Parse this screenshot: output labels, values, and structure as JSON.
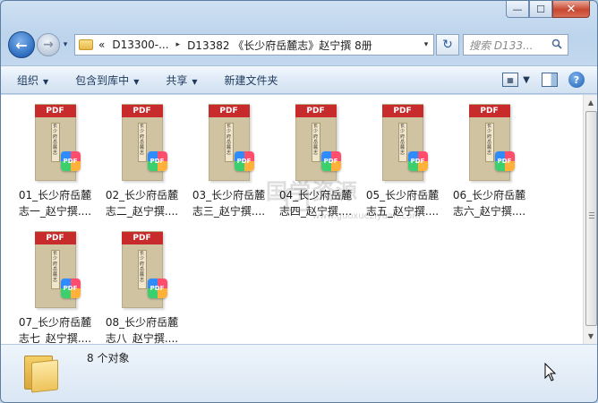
{
  "window": {
    "caption_buttons": {
      "minimize": "—",
      "maximize": "☐",
      "close": "✕"
    }
  },
  "nav": {
    "back_glyph": "←",
    "forward_glyph": "→",
    "history_glyph": "▾",
    "address": {
      "prefix": "«",
      "crumbs": [
        "D13300-...",
        "D13382 《长少府岳麓志》赵宁撰 8册"
      ],
      "separator": "▸",
      "dropdown": "▾"
    },
    "refresh_glyph": "↻",
    "search_placeholder": "搜索 D133...",
    "search_icon": "search-icon"
  },
  "toolbar": {
    "organize": "组织",
    "include_library": "包含到库中",
    "share": "共享",
    "new_folder": "新建文件夹",
    "dropdown_arrow": "▼",
    "icons": [
      "views-icon",
      "preview-pane-icon",
      "help-icon"
    ],
    "help_glyph": "?"
  },
  "files": [
    {
      "line1": "01_长少府岳麓",
      "line2": "志一_赵宁撰...."
    },
    {
      "line1": "02_长少府岳麓",
      "line2": "志二_赵宁撰...."
    },
    {
      "line1": "03_长少府岳麓",
      "line2": "志三_赵宁撰...."
    },
    {
      "line1": "04_长少府岳麓",
      "line2": "志四_赵宁撰...."
    },
    {
      "line1": "05_长少府岳麓",
      "line2": "志五_赵宁撰...."
    },
    {
      "line1": "06_长少府岳麓",
      "line2": "志六_赵宁撰...."
    },
    {
      "line1": "07_长少府岳麓",
      "line2": "志七_赵宁撰...."
    },
    {
      "line1": "08_长少府岳麓",
      "line2": "志八_赵宁撰...."
    }
  ],
  "thumbnail": {
    "band": "PDF",
    "spine": "长少府岳麓志",
    "badge": "PDF"
  },
  "watermark": {
    "text": "国学资源",
    "url": "www.guoxueziyuan.com"
  },
  "status": {
    "count": "8 个对象"
  }
}
